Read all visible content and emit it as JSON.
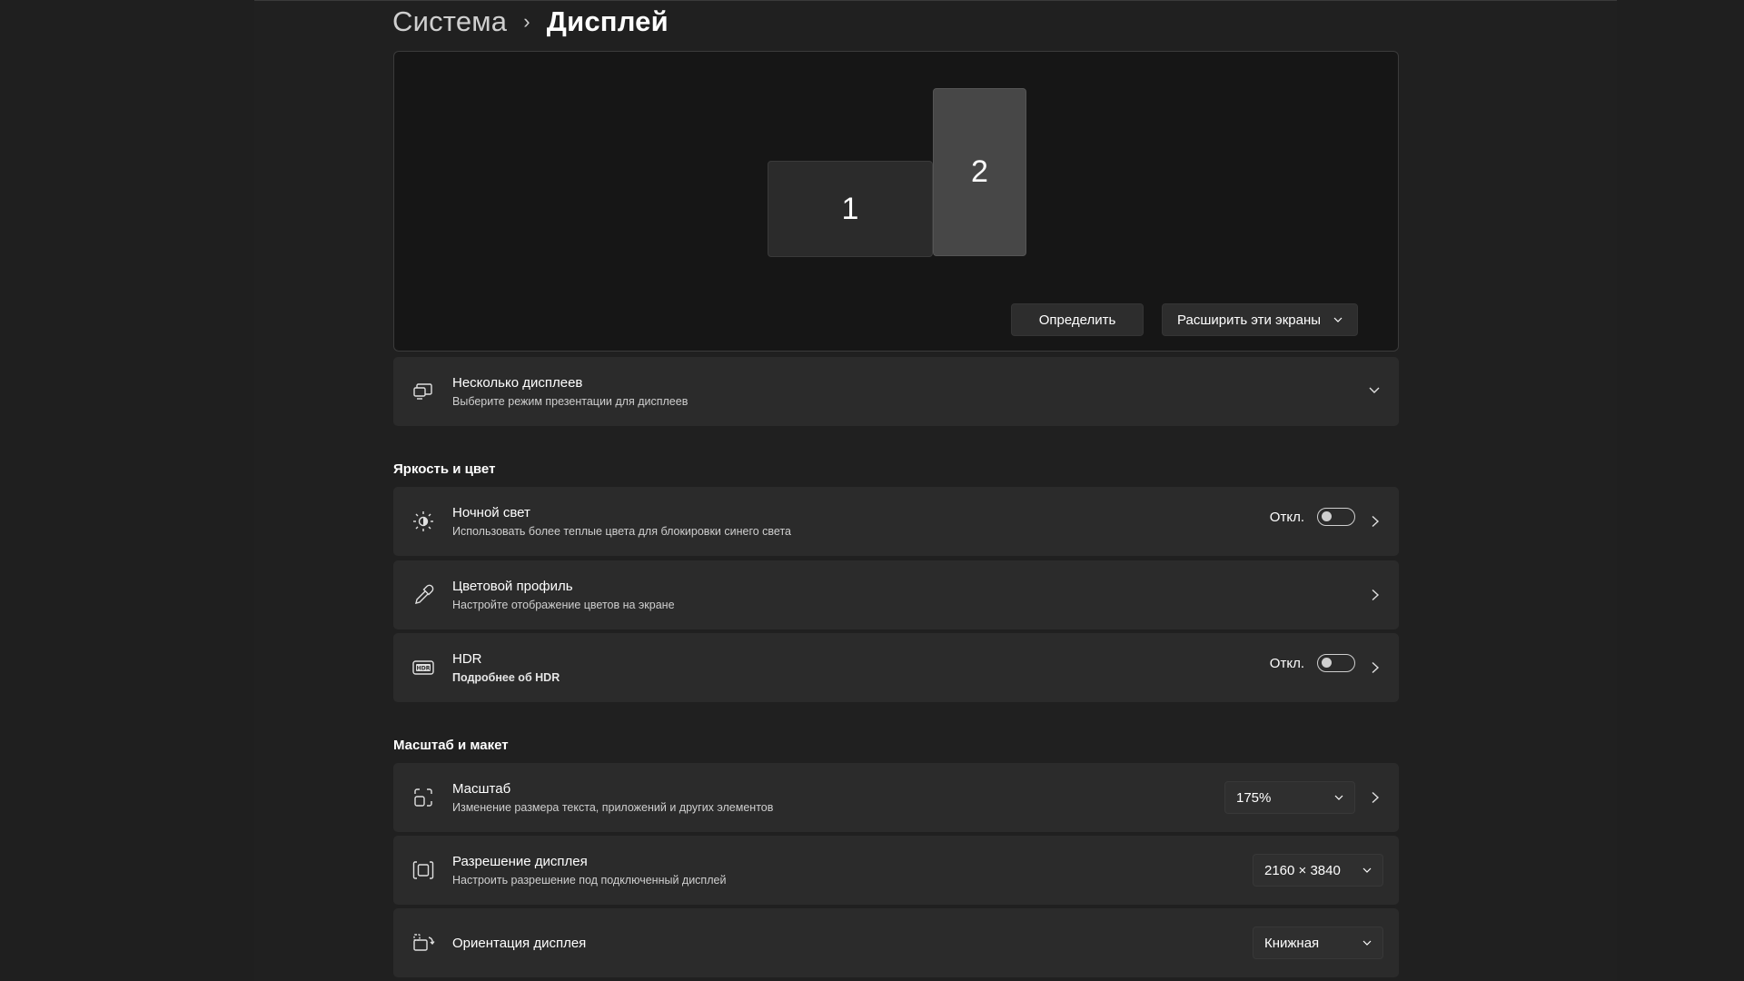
{
  "breadcrumb": {
    "parent": "Система",
    "separator": "›",
    "current": "Дисплей"
  },
  "arrangement": {
    "monitors": [
      {
        "label": "1"
      },
      {
        "label": "2"
      }
    ],
    "identify_button": "Определить",
    "extend_dropdown": {
      "value": "Расширить эти экраны",
      "icon": "chevron-down-icon"
    }
  },
  "multiple_displays": {
    "icon": "multiple-displays-icon",
    "title": "Несколько дисплеев",
    "subtitle": "Выберите режим презентации для дисплеев",
    "expand_icon": "chevron-down-icon"
  },
  "section_brightness": {
    "label": "Яркость и цвет"
  },
  "night_light": {
    "icon": "brightness-icon",
    "title": "Ночной свет",
    "subtitle": "Использовать более теплые цвета для блокировки синего света",
    "toggle_label": "Откл.",
    "toggle_on": false
  },
  "color_profile": {
    "icon": "eyedropper-icon",
    "title": "Цветовой профиль",
    "subtitle": "Настройте отображение цветов на экране"
  },
  "hdr": {
    "icon": "hdr-icon",
    "title": "HDR",
    "subtitle": "Подробнее об HDR",
    "toggle_label": "Откл.",
    "toggle_on": false
  },
  "section_scale": {
    "label": "Масштаб и макет"
  },
  "scale": {
    "icon": "scale-icon",
    "title": "Масштаб",
    "subtitle": "Изменение размера текста, приложений и других элементов",
    "value": "175%"
  },
  "resolution": {
    "icon": "resolution-icon",
    "title": "Разрешение дисплея",
    "subtitle": "Настроить разрешение под подключенный дисплей",
    "value": "2160 × 3840"
  },
  "orientation": {
    "icon": "orientation-icon",
    "title": "Ориентация дисплея",
    "value": "Книжная"
  },
  "colors": {
    "background": "#202020",
    "card": "#2b2b2b",
    "monitor_selected": "#474747"
  }
}
